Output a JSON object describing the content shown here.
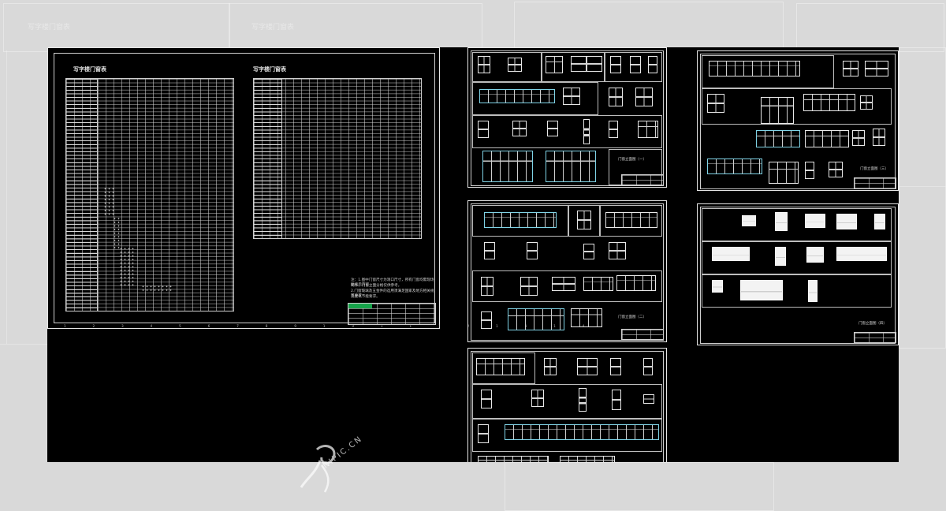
{
  "background_color": "#d9d9d9",
  "canvas_color": "#000000",
  "ghost_titles": [
    "写字楼门窗表",
    "写字楼门窗表"
  ],
  "schedule_sheet": {
    "title_left": "写字楼门窗表",
    "title_right": "写字楼门窗表",
    "notes": [
      "注：1.图中门窗尺寸为洞口尺寸，所有门窗均需现场复核后方可",
      "制作，门窗立面分格仅供参考。",
      "2.门窗玻璃及五金件的选用须满足国家及地方相关规范要求",
      "及建筑节能要求。"
    ]
  },
  "elevation_sheets": [
    {
      "id": "sheet-1",
      "caption": "门窗立面图（一）"
    },
    {
      "id": "sheet-2",
      "caption": "门窗立面图（二）"
    },
    {
      "id": "sheet-3",
      "caption": ""
    },
    {
      "id": "sheet-4",
      "caption": "门窗立面图（三）"
    },
    {
      "id": "sheet-5",
      "caption": "门窗立面图（四）"
    }
  ],
  "watermark": {
    "text": "NIPIC.CN",
    "icon": "mascot-logo"
  }
}
